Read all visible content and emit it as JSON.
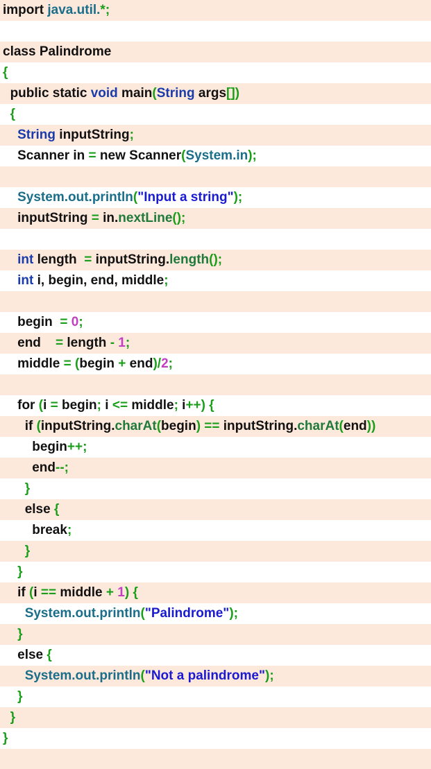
{
  "colors": {
    "stripe": "#fde8dc",
    "background": "#ffffff",
    "plain": "#111111",
    "keyword": "#111111",
    "type": "#1a3caa",
    "method": "#1f7a3c",
    "api": "#1a6e8a",
    "punctuation": "#1a9e1a",
    "number": "#c040c0",
    "string": "#1a1ad0"
  },
  "lines": [
    {
      "tokens": [
        [
          "kw",
          "import "
        ],
        [
          "api",
          "java.util."
        ],
        [
          "punct",
          "*;"
        ]
      ]
    },
    {
      "tokens": []
    },
    {
      "tokens": [
        [
          "kw",
          "class "
        ],
        [
          "ident",
          "Palindrome"
        ]
      ]
    },
    {
      "tokens": [
        [
          "punct",
          "{"
        ]
      ]
    },
    {
      "tokens": [
        [
          "plain",
          "  "
        ],
        [
          "kw",
          "public static "
        ],
        [
          "type",
          "void "
        ],
        [
          "ident",
          "main"
        ],
        [
          "punct",
          "("
        ],
        [
          "type",
          "String "
        ],
        [
          "ident",
          "args"
        ],
        [
          "punct",
          "[])"
        ]
      ]
    },
    {
      "tokens": [
        [
          "plain",
          "  "
        ],
        [
          "punct",
          "{"
        ]
      ]
    },
    {
      "tokens": [
        [
          "plain",
          "    "
        ],
        [
          "type",
          "String "
        ],
        [
          "ident",
          "inputString"
        ],
        [
          "punct",
          ";"
        ]
      ]
    },
    {
      "tokens": [
        [
          "plain",
          "    "
        ],
        [
          "ident",
          "Scanner in "
        ],
        [
          "punct",
          "= "
        ],
        [
          "kw",
          "new "
        ],
        [
          "ident",
          "Scanner"
        ],
        [
          "punct",
          "("
        ],
        [
          "api",
          "System.in"
        ],
        [
          "punct",
          ");"
        ]
      ]
    },
    {
      "tokens": []
    },
    {
      "tokens": [
        [
          "plain",
          "    "
        ],
        [
          "api",
          "System.out.println"
        ],
        [
          "punct",
          "("
        ],
        [
          "str",
          "\"Input a string\""
        ],
        [
          "punct",
          ");"
        ]
      ]
    },
    {
      "tokens": [
        [
          "plain",
          "    "
        ],
        [
          "ident",
          "inputString "
        ],
        [
          "punct",
          "= "
        ],
        [
          "ident",
          "in."
        ],
        [
          "method",
          "nextLine"
        ],
        [
          "punct",
          "();"
        ]
      ]
    },
    {
      "tokens": []
    },
    {
      "tokens": [
        [
          "plain",
          "    "
        ],
        [
          "type",
          "int "
        ],
        [
          "ident",
          "length  "
        ],
        [
          "punct",
          "= "
        ],
        [
          "ident",
          "inputString."
        ],
        [
          "method",
          "length"
        ],
        [
          "punct",
          "();"
        ]
      ]
    },
    {
      "tokens": [
        [
          "plain",
          "    "
        ],
        [
          "type",
          "int "
        ],
        [
          "ident",
          "i, begin, end, middle"
        ],
        [
          "punct",
          ";"
        ]
      ]
    },
    {
      "tokens": []
    },
    {
      "tokens": [
        [
          "plain",
          "    "
        ],
        [
          "ident",
          "begin  "
        ],
        [
          "punct",
          "= "
        ],
        [
          "num",
          "0"
        ],
        [
          "punct",
          ";"
        ]
      ]
    },
    {
      "tokens": [
        [
          "plain",
          "    "
        ],
        [
          "ident",
          "end    "
        ],
        [
          "punct",
          "= "
        ],
        [
          "ident",
          "length "
        ],
        [
          "punct",
          "- "
        ],
        [
          "num",
          "1"
        ],
        [
          "punct",
          ";"
        ]
      ]
    },
    {
      "tokens": [
        [
          "plain",
          "    "
        ],
        [
          "ident",
          "middle "
        ],
        [
          "punct",
          "= ("
        ],
        [
          "ident",
          "begin "
        ],
        [
          "punct",
          "+ "
        ],
        [
          "ident",
          "end"
        ],
        [
          "punct",
          ")/"
        ],
        [
          "num",
          "2"
        ],
        [
          "punct",
          ";"
        ]
      ]
    },
    {
      "tokens": []
    },
    {
      "tokens": [
        [
          "plain",
          "    "
        ],
        [
          "kw",
          "for "
        ],
        [
          "punct",
          "("
        ],
        [
          "ident",
          "i "
        ],
        [
          "punct",
          "= "
        ],
        [
          "ident",
          "begin"
        ],
        [
          "punct",
          "; "
        ],
        [
          "ident",
          "i "
        ],
        [
          "punct",
          "<= "
        ],
        [
          "ident",
          "middle"
        ],
        [
          "punct",
          "; "
        ],
        [
          "ident",
          "i"
        ],
        [
          "punct",
          "++) {"
        ]
      ]
    },
    {
      "tokens": [
        [
          "plain",
          "      "
        ],
        [
          "kw",
          "if "
        ],
        [
          "punct",
          "("
        ],
        [
          "ident",
          "inputString."
        ],
        [
          "method",
          "charAt"
        ],
        [
          "punct",
          "("
        ],
        [
          "ident",
          "begin"
        ],
        [
          "punct",
          ") == "
        ],
        [
          "ident",
          "inputString."
        ],
        [
          "method",
          "charAt"
        ],
        [
          "punct",
          "("
        ],
        [
          "ident",
          "end"
        ],
        [
          "punct",
          "))"
        ]
      ]
    },
    {
      "tokens": [
        [
          "plain",
          "        "
        ],
        [
          "ident",
          "begin"
        ],
        [
          "punct",
          "++;"
        ]
      ]
    },
    {
      "tokens": [
        [
          "plain",
          "        "
        ],
        [
          "ident",
          "end"
        ],
        [
          "punct",
          "--;"
        ]
      ]
    },
    {
      "tokens": [
        [
          "plain",
          "      "
        ],
        [
          "punct",
          "}"
        ]
      ]
    },
    {
      "tokens": [
        [
          "plain",
          "      "
        ],
        [
          "kw",
          "else "
        ],
        [
          "punct",
          "{"
        ]
      ]
    },
    {
      "tokens": [
        [
          "plain",
          "        "
        ],
        [
          "kw",
          "break"
        ],
        [
          "punct",
          ";"
        ]
      ]
    },
    {
      "tokens": [
        [
          "plain",
          "      "
        ],
        [
          "punct",
          "}"
        ]
      ]
    },
    {
      "tokens": [
        [
          "plain",
          "    "
        ],
        [
          "punct",
          "}"
        ]
      ]
    },
    {
      "tokens": [
        [
          "plain",
          "    "
        ],
        [
          "kw",
          "if "
        ],
        [
          "punct",
          "("
        ],
        [
          "ident",
          "i "
        ],
        [
          "punct",
          "== "
        ],
        [
          "ident",
          "middle "
        ],
        [
          "punct",
          "+ "
        ],
        [
          "num",
          "1"
        ],
        [
          "punct",
          ") {"
        ]
      ]
    },
    {
      "tokens": [
        [
          "plain",
          "      "
        ],
        [
          "api",
          "System.out.println"
        ],
        [
          "punct",
          "("
        ],
        [
          "str",
          "\"Palindrome\""
        ],
        [
          "punct",
          ");"
        ]
      ]
    },
    {
      "tokens": [
        [
          "plain",
          "    "
        ],
        [
          "punct",
          "}"
        ]
      ]
    },
    {
      "tokens": [
        [
          "plain",
          "    "
        ],
        [
          "kw",
          "else "
        ],
        [
          "punct",
          "{"
        ]
      ]
    },
    {
      "tokens": [
        [
          "plain",
          "      "
        ],
        [
          "api",
          "System.out.println"
        ],
        [
          "punct",
          "("
        ],
        [
          "str",
          "\"Not a palindrome\""
        ],
        [
          "punct",
          ");"
        ]
      ]
    },
    {
      "tokens": [
        [
          "plain",
          "    "
        ],
        [
          "punct",
          "}"
        ]
      ]
    },
    {
      "tokens": [
        [
          "plain",
          "  "
        ],
        [
          "punct",
          "}"
        ]
      ]
    },
    {
      "tokens": [
        [
          "punct",
          "}"
        ]
      ]
    },
    {
      "tokens": []
    }
  ]
}
